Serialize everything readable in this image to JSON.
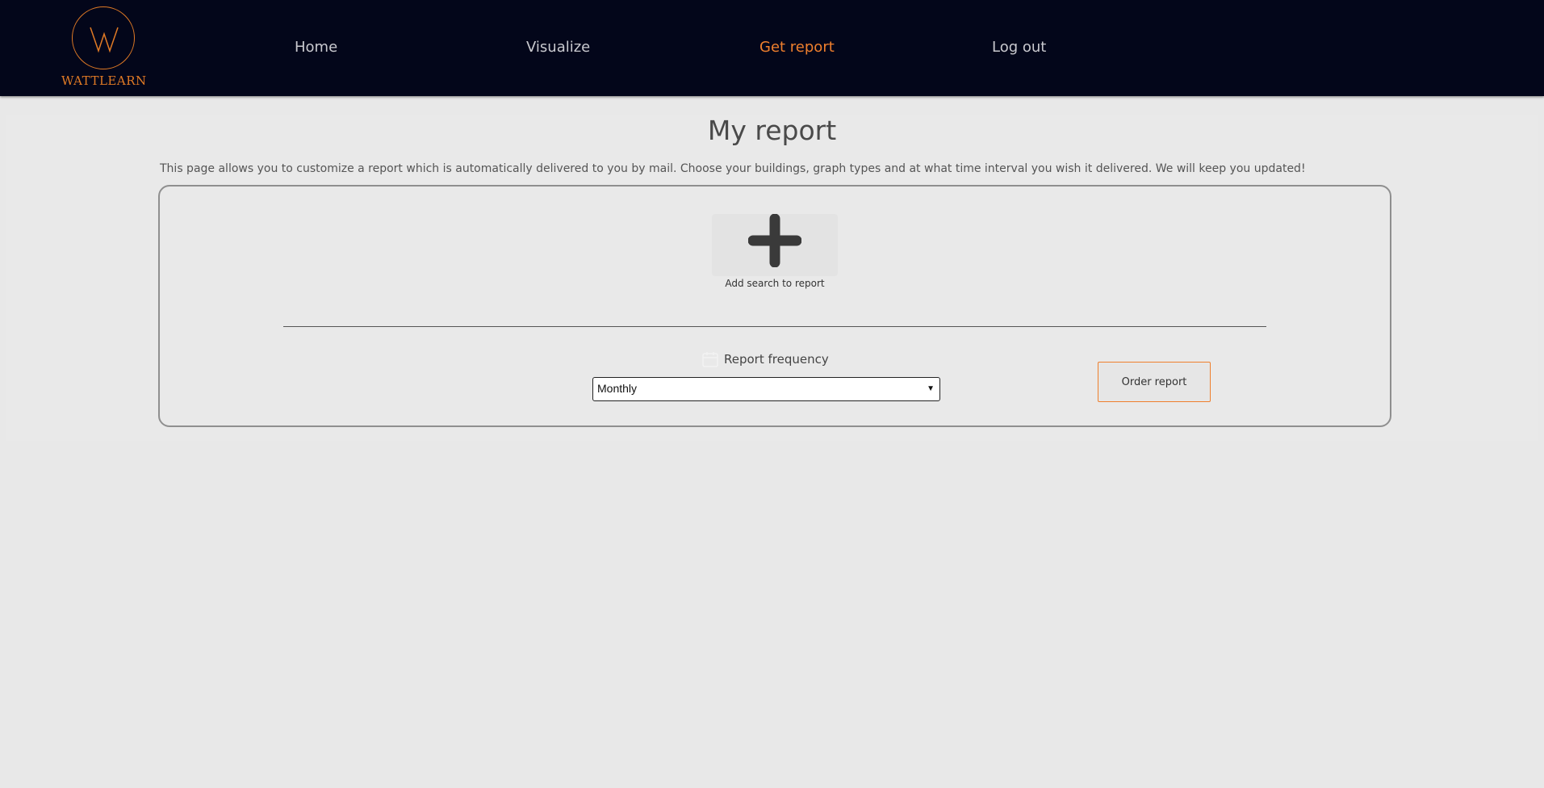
{
  "brand": {
    "logo_letter": "W",
    "logo_text": "WATTLEARN",
    "accent_color": "#ef7f2d",
    "header_bg": "#03061a"
  },
  "nav": {
    "items": [
      {
        "label": "Home",
        "active": false
      },
      {
        "label": "Visualize",
        "active": false
      },
      {
        "label": "Get report",
        "active": true
      },
      {
        "label": "Log out",
        "active": false
      }
    ]
  },
  "main": {
    "title": "My report",
    "description": "This page allows you to customize a report which is automatically delivered to you by mail. Choose your buildings, graph types and at what time interval you wish it delivered. We will keep you updated!"
  },
  "report": {
    "add_search_label": "Add search to report",
    "add_icon": "plus-icon",
    "frequency_label": "Report frequency",
    "frequency_icon": "calendar-icon",
    "frequency_value": "Monthly",
    "order_button": "Order report"
  }
}
